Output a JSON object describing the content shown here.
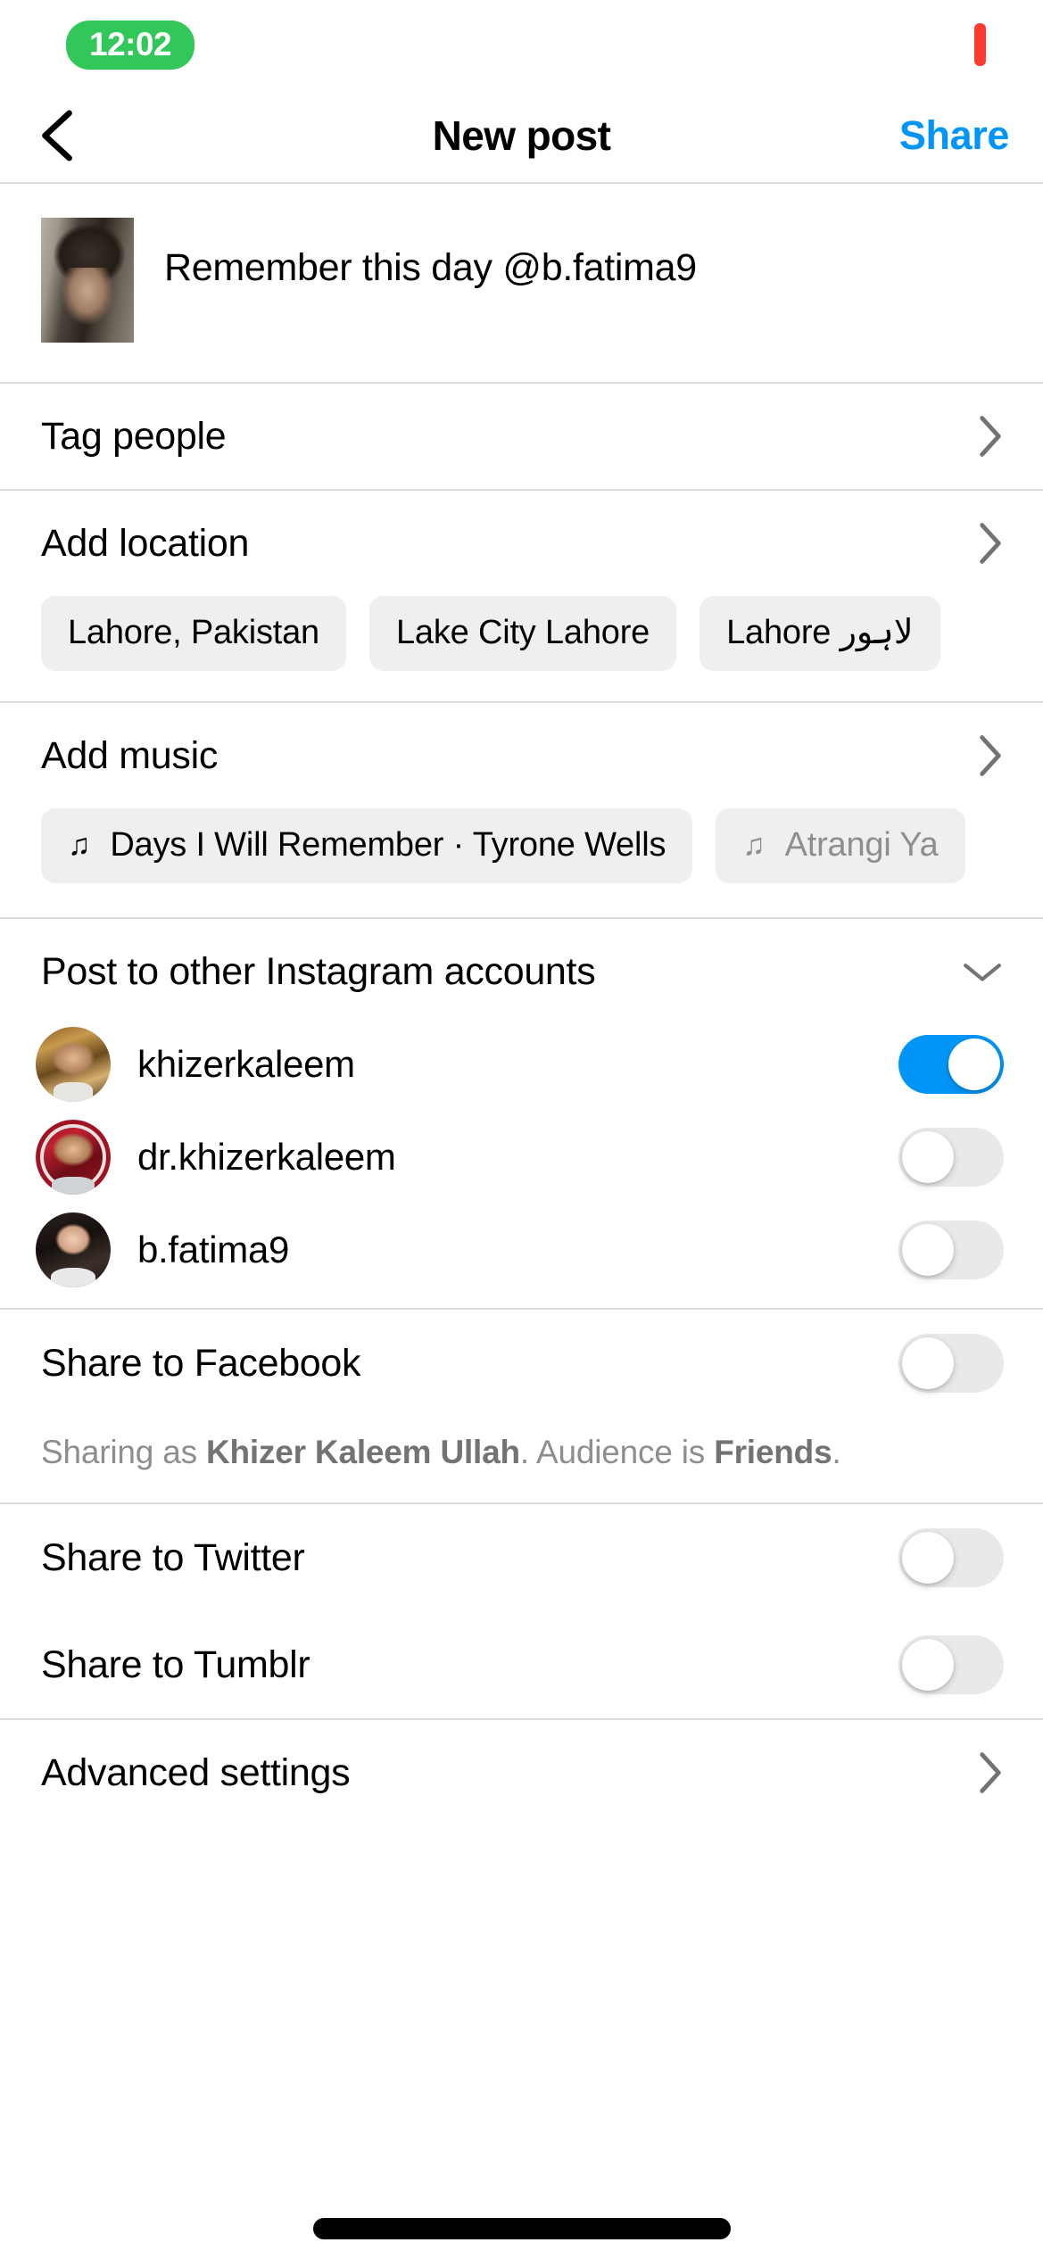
{
  "status_bar": {
    "recording_time": "12:02",
    "recording_indicator": "record-dot"
  },
  "nav": {
    "back_icon": "chevron-left-icon",
    "title": "New post",
    "share_label": "Share"
  },
  "caption": {
    "text": "Remember this day @b.fatima9",
    "thumbnail_alt": "post-thumbnail"
  },
  "tag_people": {
    "label": "Tag people",
    "chevron": "chevron-right-icon"
  },
  "location": {
    "label": "Add location",
    "chevron": "chevron-right-icon",
    "suggestions": [
      {
        "label": "Lahore, Pakistan",
        "faded": false
      },
      {
        "label": "Lake City Lahore",
        "faded": false
      },
      {
        "label": "Lahore لاہور",
        "faded": false
      }
    ]
  },
  "music": {
    "label": "Add music",
    "chevron": "chevron-right-icon",
    "note_icon": "music-note-icon",
    "suggestions": [
      {
        "label": "Days I Will Remember · Tyrone Wells",
        "faded": false
      },
      {
        "label": "Atrangi Ya",
        "faded": true
      }
    ]
  },
  "other_accounts": {
    "label": "Post to other Instagram accounts",
    "chevron": "chevron-down-icon",
    "accounts": [
      {
        "name": "khizerkaleem",
        "enabled": true,
        "avatar": "av-1"
      },
      {
        "name": "dr.khizerkaleem",
        "enabled": false,
        "avatar": "av-2"
      },
      {
        "name": "b.fatima9",
        "enabled": false,
        "avatar": "av-3"
      }
    ]
  },
  "share_targets": [
    {
      "label": "Share to Facebook",
      "enabled": false
    },
    {
      "label": "Share to Twitter",
      "enabled": false
    },
    {
      "label": "Share to Tumblr",
      "enabled": false
    }
  ],
  "facebook_note": {
    "prefix": "Sharing as ",
    "name": "Khizer Kaleem Ullah",
    "middle": ". Audience is ",
    "audience": "Friends",
    "suffix": "."
  },
  "advanced_settings": {
    "label": "Advanced settings",
    "chevron": "chevron-right-icon"
  },
  "colors": {
    "accent_blue": "#0095F6",
    "record_green": "#32C759",
    "record_red": "#FF3B30",
    "chip_grey": "#EFEFEF",
    "toggle_off": "#E9E9EA",
    "muted_text": "#8E8E8E"
  }
}
